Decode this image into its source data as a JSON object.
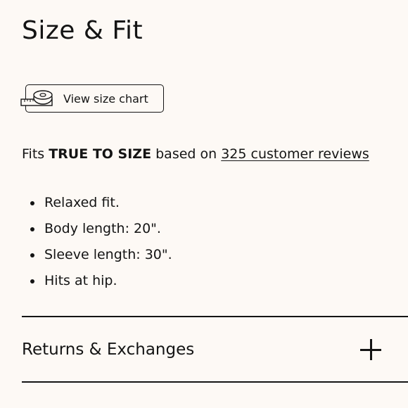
{
  "section": {
    "title": "Size & Fit"
  },
  "size_chart": {
    "label": "View size chart",
    "icon": "tape-measure-icon"
  },
  "fit": {
    "prefix": "Fits ",
    "emphasis": "TRUE TO SIZE",
    "middle": " based on ",
    "reviews_link": "325 customer reviews"
  },
  "details": [
    "Relaxed fit.",
    "Body length: 20\".",
    "Sleeve length: 30\".",
    "Hits at hip."
  ],
  "accordion": {
    "label": "Returns & Exchanges",
    "icon": "plus-icon"
  },
  "colors": {
    "background": "#fdf9f5",
    "text": "#141414"
  }
}
